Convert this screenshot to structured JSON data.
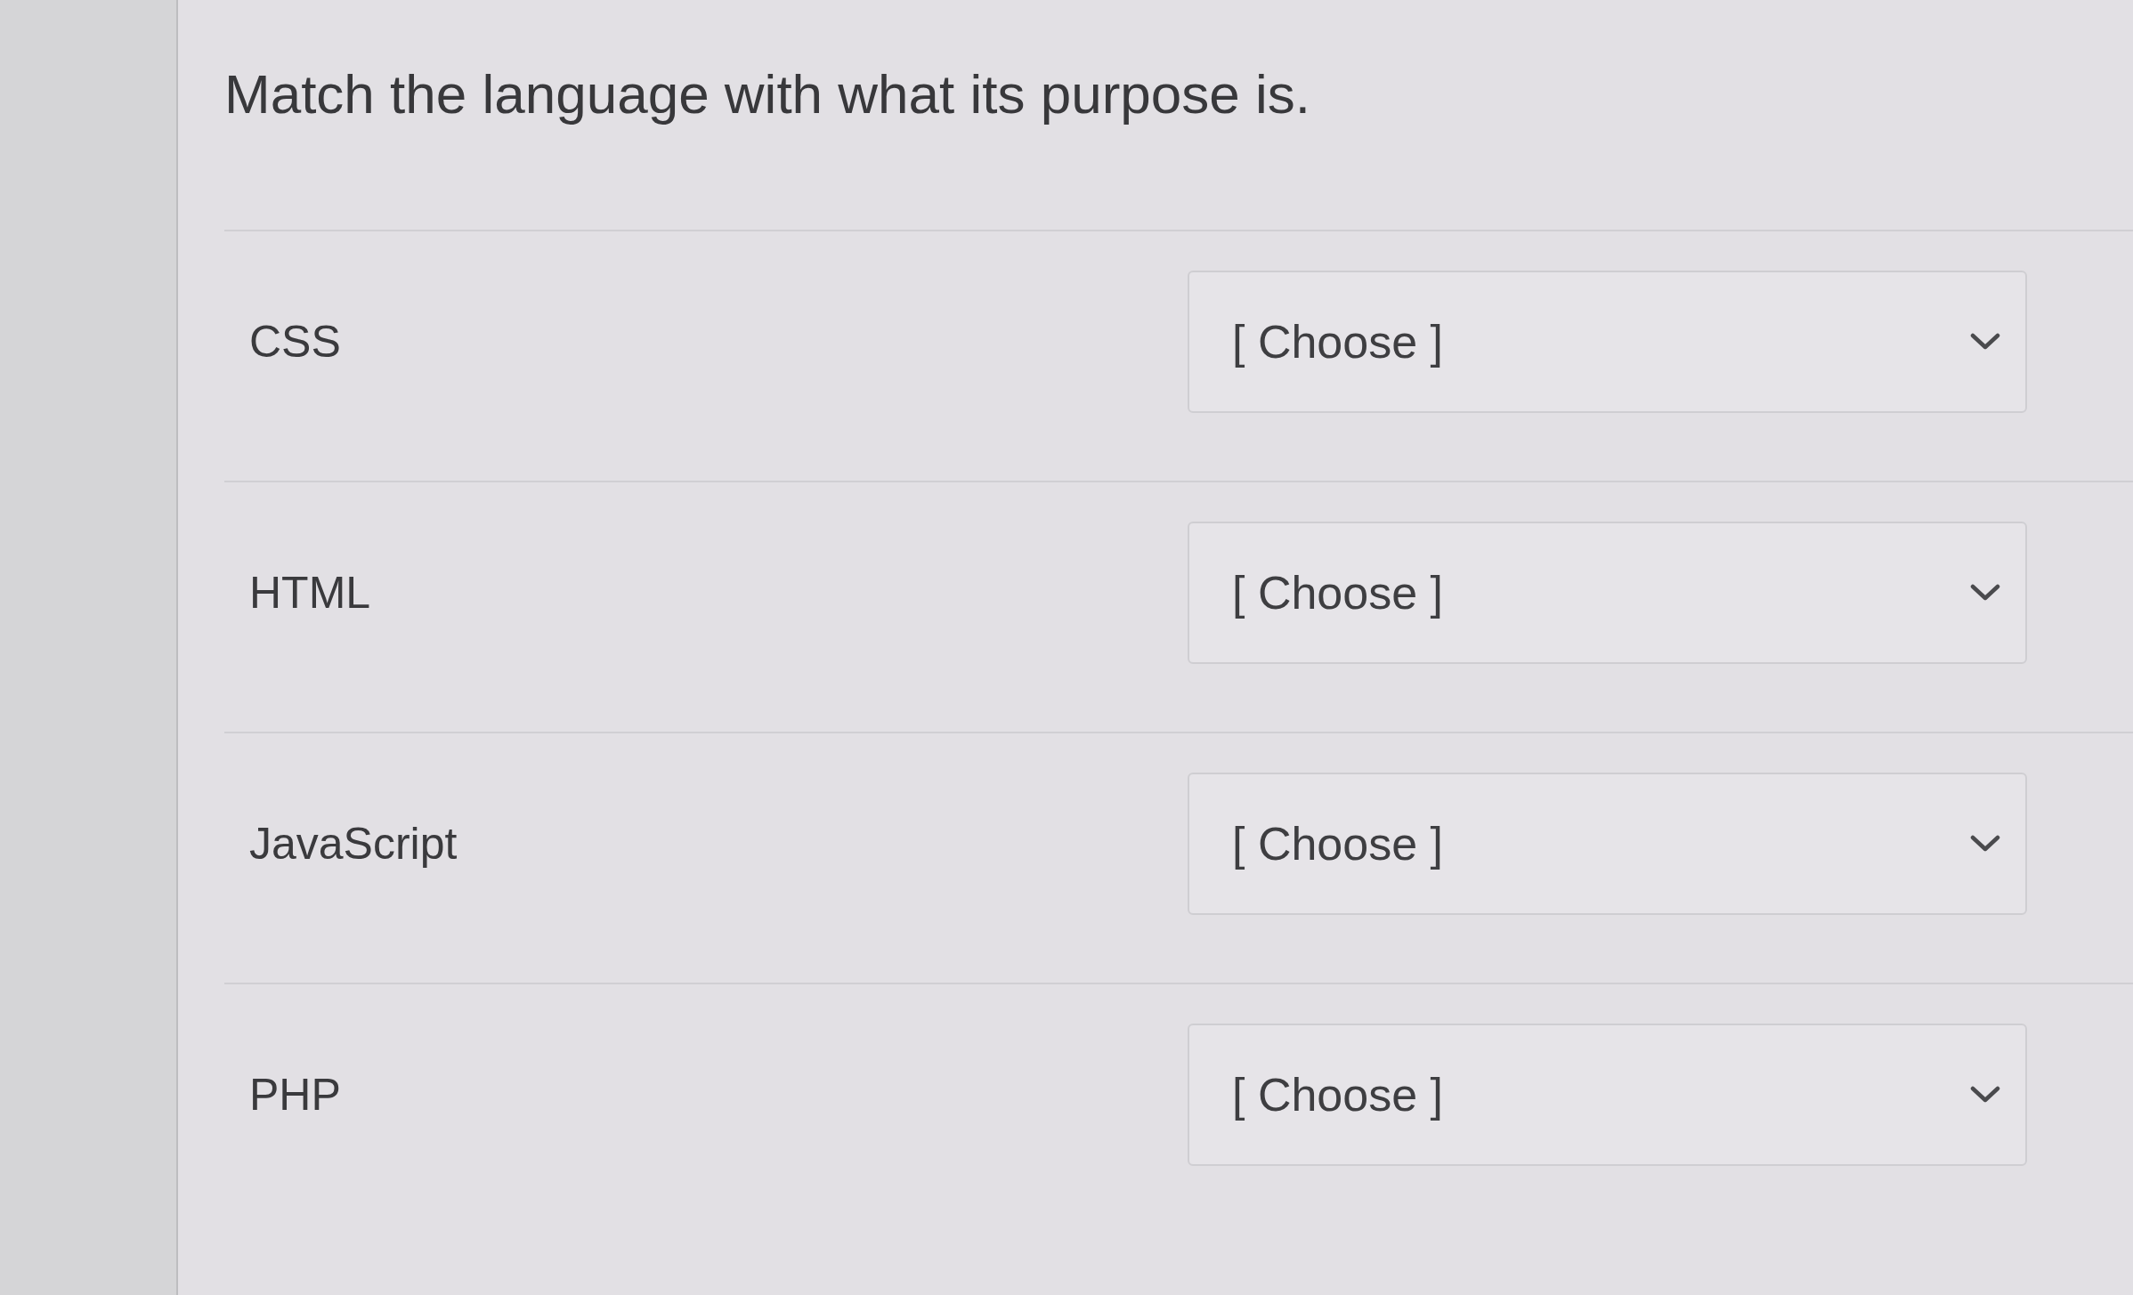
{
  "question": {
    "prompt": "Match the language with what its purpose is."
  },
  "pairs": [
    {
      "term": "CSS",
      "dropdown": {
        "value": "[ Choose ]"
      }
    },
    {
      "term": "HTML",
      "dropdown": {
        "value": "[ Choose ]"
      }
    },
    {
      "term": "JavaScript",
      "dropdown": {
        "value": "[ Choose ]"
      }
    },
    {
      "term": "PHP",
      "dropdown": {
        "value": "[ Choose ]"
      }
    }
  ]
}
